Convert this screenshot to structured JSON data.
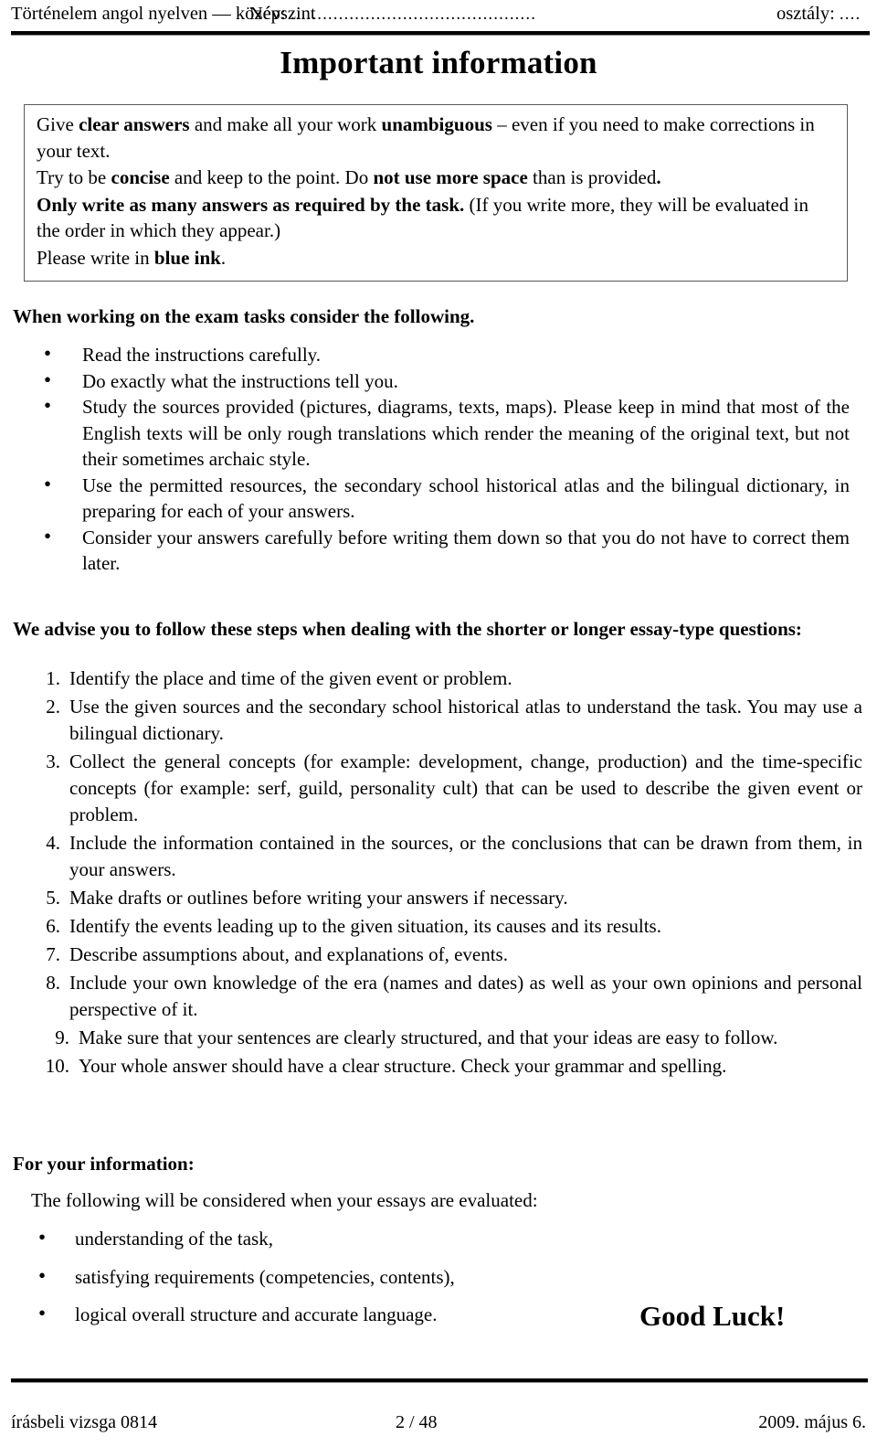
{
  "header": {
    "subject": "Történelem angol nyelven — középszint",
    "name_label": "Név:",
    "name_dots": "..............................................",
    "class_label": "osztály:",
    "class_dots": "...."
  },
  "title": "Important information",
  "framed_box": {
    "paragraph_1_pre": "Give ",
    "paragraph_1_b1": "clear answers",
    "paragraph_1_mid": " and make all your work ",
    "paragraph_1_b2": "unambiguous",
    "paragraph_1_post": " – even if you need to make corrections in your text.",
    "paragraph_2_pre": "Try to be ",
    "paragraph_2_b1": "concise",
    "paragraph_2_mid": " and keep to the point. Do ",
    "paragraph_2_b2": "not use more space",
    "paragraph_2_post": " than is provided",
    "paragraph_2_b3": ".",
    "paragraph_3_b1": "Only write as many answers as required by the task.",
    "paragraph_3_post": " (If you write more, they will be evaluated in the order in which they appear.)",
    "paragraph_4_pre": "Please write in ",
    "paragraph_4_b1": "blue ink",
    "paragraph_4_post": "."
  },
  "section_exam": {
    "heading": "When working on the exam tasks consider the following.",
    "bullets": [
      "Read the instructions carefully.",
      "Do exactly what the instructions tell you.",
      "Study the sources provided (pictures, diagrams, texts, maps). Please keep in mind that most of the English texts will be only rough translations which render the meaning of the original text, but not their sometimes archaic style.",
      "Use the permitted resources, the secondary school historical atlas and the bilingual dictionary, in preparing for each of  your answers.",
      "Consider your answers carefully before writing them down so that you do not have to correct them later."
    ]
  },
  "section_steps": {
    "heading": "We advise you to follow these steps when dealing with the shorter or longer essay-type questions:",
    "items": [
      {
        "num": "1.",
        "text": "Identify the place and time of the given event or problem."
      },
      {
        "num": "2.",
        "text": "Use the given sources and the secondary school historical atlas to understand the task. You may use a bilingual dictionary."
      },
      {
        "num": "3.",
        "text": "Collect the general concepts (for example: development, change, production) and the time-specific concepts (for example: serf, guild, personality cult) that can be used to describe the given event or problem."
      },
      {
        "num": "4.",
        "text": "Include the information contained in the sources, or the conclusions that can be drawn from them, in your answers."
      },
      {
        "num": "5.",
        "text": "Make drafts or outlines before writing your answers if necessary."
      },
      {
        "num": "6.",
        "text": "Identify the events leading up to the given situation, its causes and its results."
      },
      {
        "num": "7.",
        "text": "Describe assumptions about, and explanations of, events."
      },
      {
        "num": "8.",
        "text": "Include your own knowledge of the era (names and dates) as well as your own opinions and personal perspective of it."
      },
      {
        "num": "9.",
        "text": "Make sure that your sentences are clearly structured, and that your ideas are easy to follow."
      },
      {
        "num": "10.",
        "text": "Your whole answer should have a clear structure. Check your grammar and spelling."
      }
    ]
  },
  "section_info": {
    "heading": "For your information:",
    "intro": "The following will be considered when your essays are evaluated:",
    "bullets": [
      "understanding of the task,",
      "satisfying requirements (competencies, contents),",
      "logical overall structure and accurate language."
    ]
  },
  "good_luck": "Good Luck!",
  "footer": {
    "left": "írásbeli vizsga 0814",
    "center": "2 / 48",
    "right": "2009. május 6."
  }
}
